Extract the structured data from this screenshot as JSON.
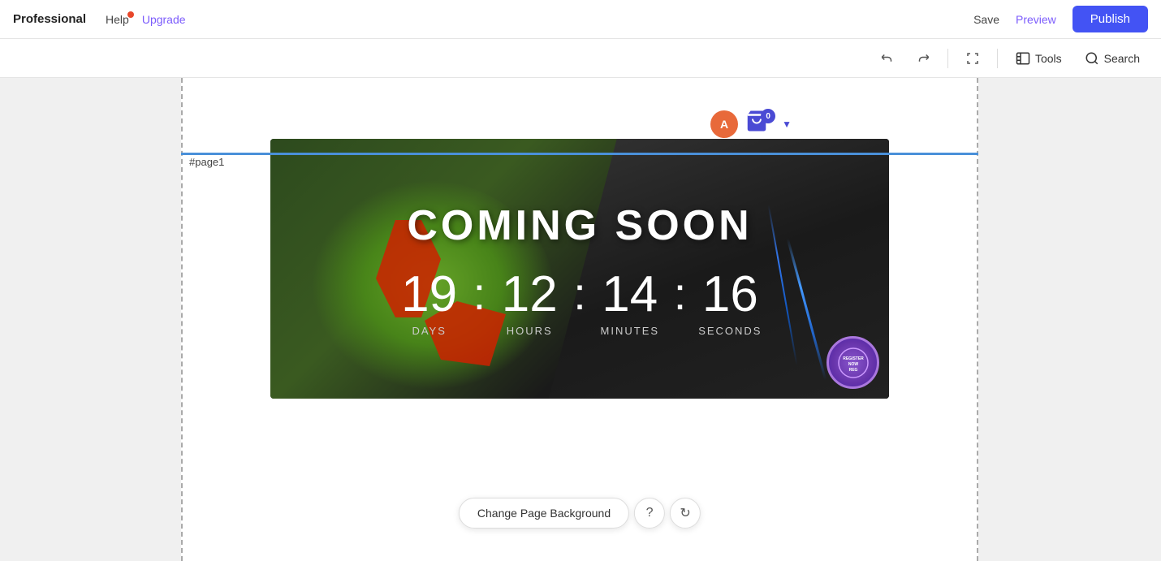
{
  "topnav": {
    "brand": "Professional",
    "help": "Help",
    "upgrade": "Upgrade",
    "save": "Save",
    "preview": "Preview",
    "publish": "Publish"
  },
  "toolbar": {
    "tools_label": "Tools",
    "search_label": "Search"
  },
  "page": {
    "label": "#page1"
  },
  "countdown": {
    "title": "COMING SOON",
    "days_value": "19",
    "days_label": "DAYS",
    "hours_value": "12",
    "hours_label": "HOURS",
    "minutes_value": "14",
    "minutes_label": "MINUTES",
    "seconds_value": "16",
    "seconds_label": "SECONDS",
    "colon": ":"
  },
  "bottombar": {
    "change_bg": "Change Page Background",
    "help_icon": "?",
    "refresh_icon": "↻"
  },
  "cart": {
    "avatar": "A",
    "badge": "0"
  }
}
